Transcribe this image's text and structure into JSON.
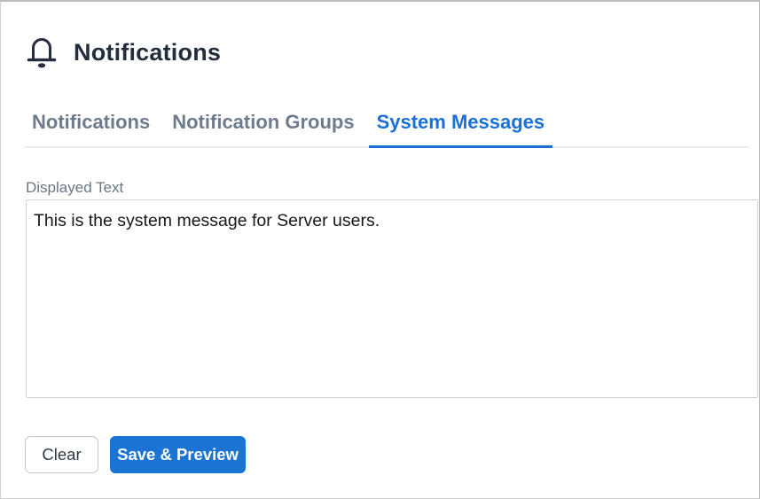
{
  "page": {
    "title": "Notifications",
    "title_icon": "bell-icon"
  },
  "tabs": [
    {
      "label": "Notifications",
      "active": false
    },
    {
      "label": "Notification Groups",
      "active": false
    },
    {
      "label": "System Messages",
      "active": true
    }
  ],
  "form": {
    "displayed_text_label": "Displayed Text",
    "displayed_text_value": "This is the system message for Server users."
  },
  "buttons": {
    "clear_label": "Clear",
    "save_preview_label": "Save & Preview"
  },
  "colors": {
    "header_text": "#222d3d",
    "inactive_tab_gray": "#6e7b8c",
    "active_tab_blue": "#1a70d6",
    "tab_divider_gray": "#e9edf2",
    "textarea_border": "#ccd7e4",
    "primary_button_blue": "#1b74d3",
    "page_border_gray": "#bcbcbc"
  }
}
